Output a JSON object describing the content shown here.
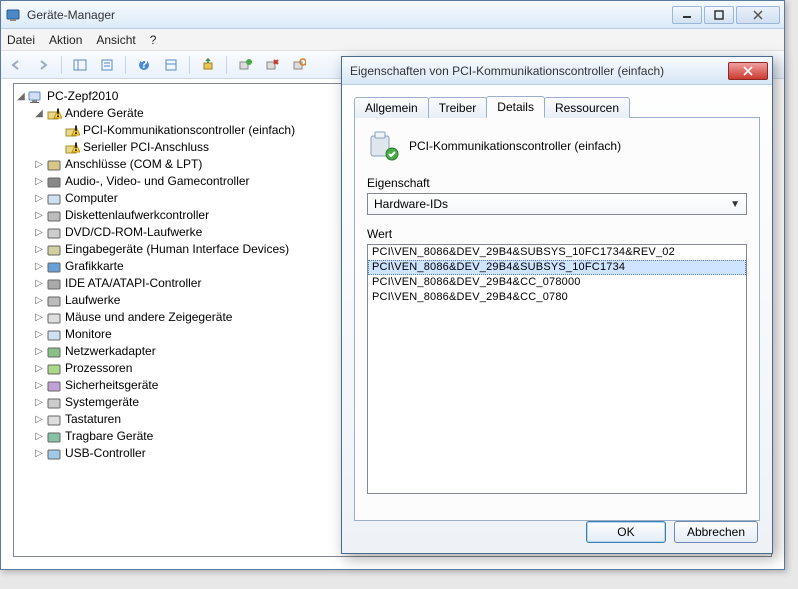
{
  "main_window": {
    "title": "Geräte-Manager",
    "menu": {
      "file": "Datei",
      "action": "Aktion",
      "view": "Ansicht",
      "help": "?"
    }
  },
  "tree": {
    "root": "PC-Zepf2010",
    "other_devices": {
      "label": "Andere Geräte",
      "children": [
        "PCI-Kommunikationscontroller (einfach)",
        "Serieller PCI-Anschluss"
      ]
    },
    "items": [
      "Anschlüsse (COM & LPT)",
      "Audio-, Video- und Gamecontroller",
      "Computer",
      "Diskettenlaufwerkcontroller",
      "DVD/CD-ROM-Laufwerke",
      "Eingabegeräte (Human Interface Devices)",
      "Grafikkarte",
      "IDE ATA/ATAPI-Controller",
      "Laufwerke",
      "Mäuse und andere Zeigegeräte",
      "Monitore",
      "Netzwerkadapter",
      "Prozessoren",
      "Sicherheitsgeräte",
      "Systemgeräte",
      "Tastaturen",
      "Tragbare Geräte",
      "USB-Controller"
    ]
  },
  "dialog": {
    "title": "Eigenschaften von PCI-Kommunikationscontroller (einfach)",
    "tabs": {
      "general": "Allgemein",
      "driver": "Treiber",
      "details": "Details",
      "resources": "Ressourcen"
    },
    "device_name": "PCI-Kommunikationscontroller (einfach)",
    "property_label": "Eigenschaft",
    "property_value": "Hardware-IDs",
    "value_label": "Wert",
    "values": [
      "PCI\\VEN_8086&DEV_29B4&SUBSYS_10FC1734&REV_02",
      "PCI\\VEN_8086&DEV_29B4&SUBSYS_10FC1734",
      "PCI\\VEN_8086&DEV_29B4&CC_078000",
      "PCI\\VEN_8086&DEV_29B4&CC_0780"
    ],
    "selected_index": 1,
    "ok": "OK",
    "cancel": "Abbrechen"
  }
}
